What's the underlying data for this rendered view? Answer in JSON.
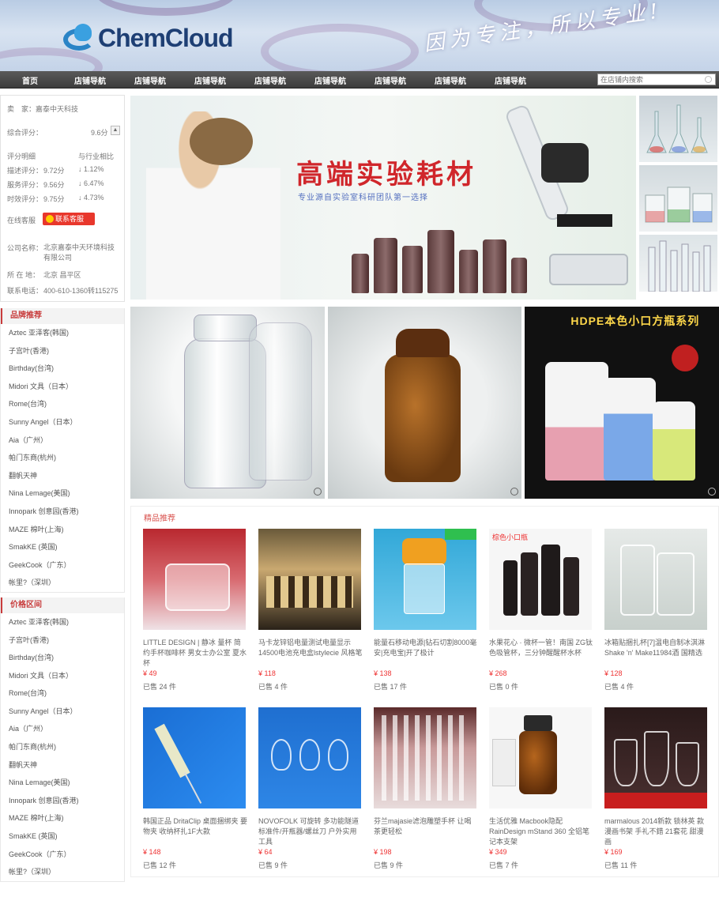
{
  "header": {
    "logo_text": "ChemCloud",
    "slogan": "因为专注，所以专业!"
  },
  "nav": {
    "items": [
      {
        "label": "首页"
      },
      {
        "label": "店铺导航"
      },
      {
        "label": "店铺导航"
      },
      {
        "label": "店铺导航"
      },
      {
        "label": "店铺导航"
      },
      {
        "label": "店铺导航"
      },
      {
        "label": "店铺导航"
      },
      {
        "label": "店铺导航"
      },
      {
        "label": "店铺导航"
      }
    ],
    "search_placeholder": "在店铺内搜索"
  },
  "shop": {
    "breadcrumb": "卖　家：嘉泰中天科技",
    "score_label": "综合评分：",
    "score_value": "9.6分",
    "col1": "评分明细",
    "col2": "与行业相比",
    "rows": [
      {
        "label": "描述评分：",
        "value": "9.72分",
        "delta": "↓ 1.12%"
      },
      {
        "label": "服务评分：",
        "value": "9.56分",
        "delta": "↓ 6.47%"
      },
      {
        "label": "时效评分：",
        "value": "9.75分",
        "delta": "↓ 4.73%"
      }
    ],
    "online_label": "在线客服",
    "service_button": "联系客服",
    "company_label": "公司名称：",
    "company_value": "北京嘉泰中天环境科技有限公司",
    "location_label": "所 在 地：",
    "location_value": "北京 昌平区",
    "phone_label": "联系电话：",
    "phone_value": "400-610-1360转115275"
  },
  "categories": [
    {
      "title": "品牌推荐",
      "items": [
        "Aztec 亚泽客(韩国)",
        "子宫叶(香港)",
        "Birthday(台湾)",
        "Midori 文具（日本）",
        "Rome(台湾)",
        "Sunny Angel（日本）",
        "Aia（广州）",
        "帕门东商(杭州)",
        "翻帆天神",
        "Nina Lemage(美国)",
        "Innopark 创意园(香港)",
        "MAZE 棉叶(上海)",
        "SmakKE (英国)",
        "GeekCook（广东）",
        "帐里?（深圳）"
      ]
    },
    {
      "title": "价格区间",
      "items": [
        "Aztec 亚泽客(韩国)",
        "子宫叶(香港)",
        "Birthday(台湾)",
        "Midori 文具（日本）",
        "Rome(台湾)",
        "Sunny Angel（日本）",
        "Aia（广州）",
        "帕门东商(杭州)",
        "翻帆天神",
        "Nina Lemage(美国)",
        "Innopark 创意园(香港)",
        "MAZE 棉叶(上海)",
        "SmakKE (英国)",
        "GeekCook（广东）",
        "帐里?（深圳）"
      ]
    }
  ],
  "hero": {
    "title": "高端实验耗材",
    "subtitle": "专业源自实验室科研团队第一选择"
  },
  "banner3": {
    "hdpe_title": "HDPE本色小口方瓶系列"
  },
  "products": {
    "section_title": "精品推荐",
    "items": [
      {
        "title": "LITTLE DESIGN | 静冰 量杯 简约手杯咖啡杯 男女士办公室 夏水杯",
        "price": "¥ 49",
        "sold": "已售 24 件"
      },
      {
        "title": "马卡龙锌铝电量测试电量显示14500电池充电盒lstylecie 风格笔",
        "price": "¥ 118",
        "sold": "已售 4 件"
      },
      {
        "title": "能量石移动电源|钻石切割8000毫安|充电宝|开了极计",
        "price": "¥ 138",
        "sold": "已售 17 件"
      },
      {
        "title": "水果花心 · 微杯一管！南国 ZG钛色吸管杯，三分钟醒醒杯水杯",
        "price": "¥ 268",
        "sold": "已售 0 件"
      },
      {
        "title": "冰箱贴捆扎杯[7]温电自制冰淇淋Shake 'n' Make11984酒 国精选",
        "price": "¥ 128",
        "sold": "已售 4 件"
      },
      {
        "title": "韩国正品 DritaClip 桌面捆绑夹 要物夹 收纳杯扎1F大款",
        "price": "¥ 148",
        "sold": "已售 12 件"
      },
      {
        "title": "NOVOFOLK 可旋转 多功能隧道标准件/开瓶器/螺丝刀 户外实用工具",
        "price": "¥ 64",
        "sold": "已售 9 件"
      },
      {
        "title": "芬兰majasie滤泡雕塑手杯 让喝茶更轻松",
        "price": "¥ 198",
        "sold": "已售 9 件"
      },
      {
        "title": "生活优雅 Macbook隐配 RainDesign mStand 360 全铝笔记本支架",
        "price": "¥ 349",
        "sold": "已售 7 件"
      },
      {
        "title": "marmalous 2014新款 锁林英 款漫画书架 手礼不錯 21套花 甜漫画",
        "price": "¥ 169",
        "sold": "已售 11 件"
      }
    ]
  }
}
